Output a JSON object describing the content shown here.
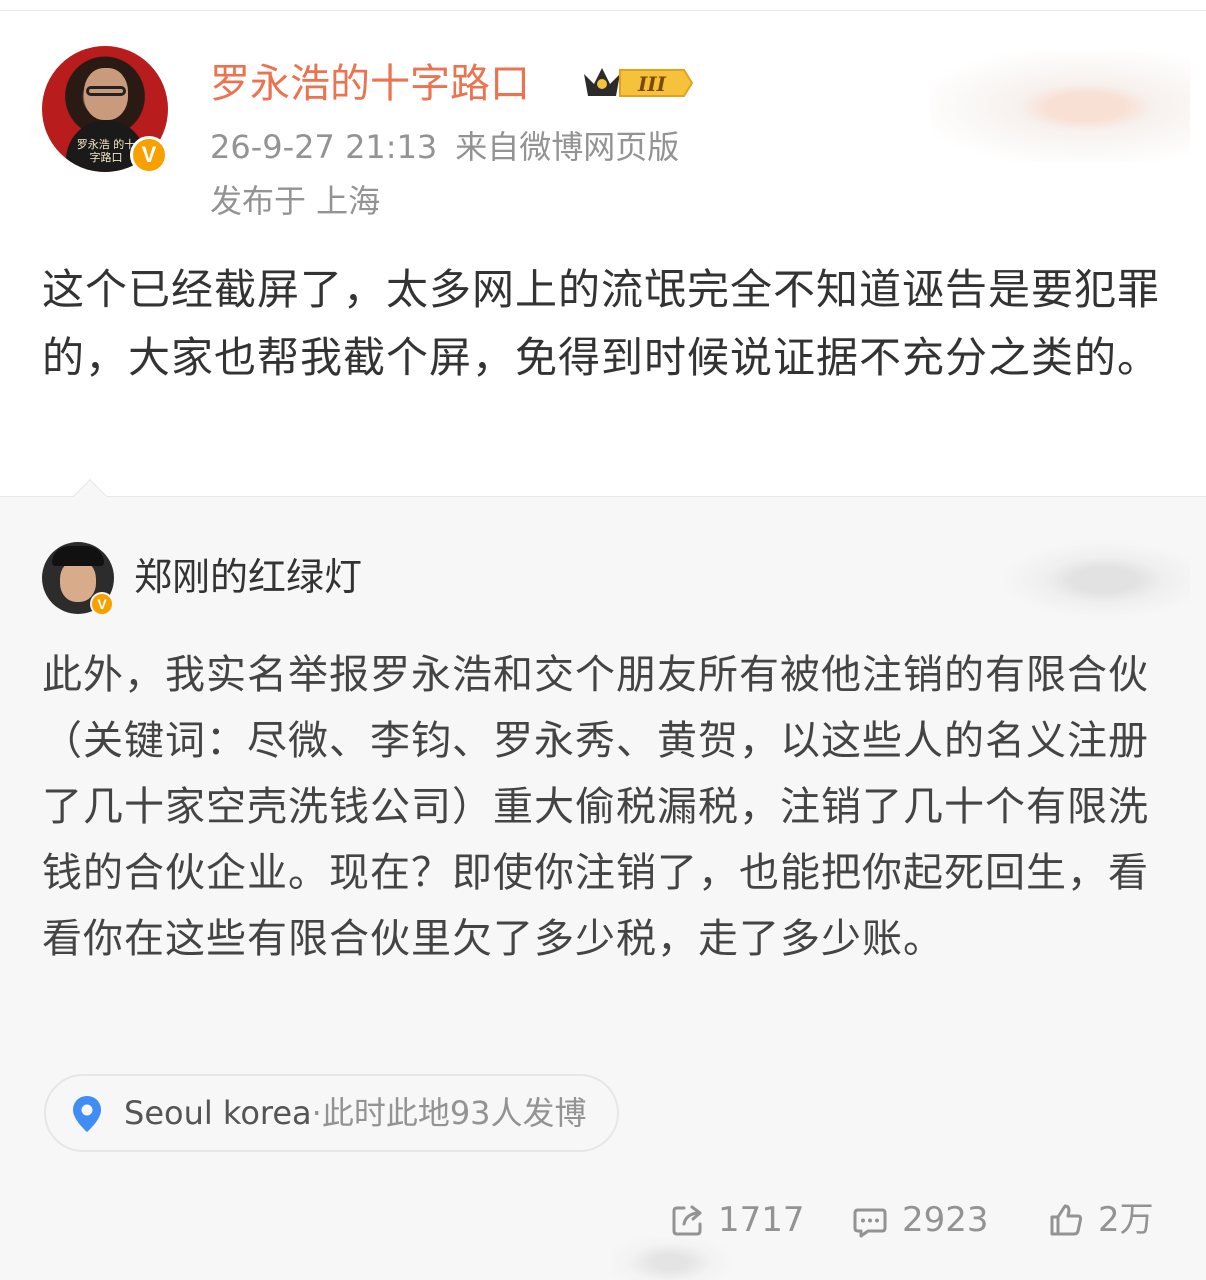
{
  "post": {
    "author": "罗永浩的十字路口",
    "avatar_caption": "罗永浩 的十字路口",
    "verified_mark": "V",
    "level_badge": "III",
    "timestamp": "26-9-27 21:13",
    "source": "来自微博网页版",
    "published_location": "发布于 上海",
    "text": "这个已经截屏了，太多网上的流氓完全不知道诬告是要犯罪的，大家也帮我截个屏，免得到时候说证据不充分之类的。"
  },
  "repost": {
    "author": "郑刚的红绿灯",
    "verified_mark": "V",
    "text": "此外，我实名举报罗永浩和交个朋友所有被他注销的有限合伙（关键词：尽微、李钧、罗永秀、黄贺，以这些人的名义注册了几十家空壳洗钱公司）重大偷税漏税，注销了几十个有限洗钱的合伙企业。现在？即使你注销了，也能把你起死回生，看看你在这些有限合伙里欠了多少税，走了多少账。",
    "location_tag": {
      "place": "Seoul korea",
      "count_text": "·此时此地93人发博"
    }
  },
  "actions": {
    "repost_count": "1717",
    "comment_count": "2923",
    "like_count": "2万"
  },
  "colors": {
    "username": "#eb7350",
    "meta": "#939393",
    "repost_bg": "#f7f7f7",
    "verified": "#f6a100",
    "location_pin": "#3f8df5"
  },
  "icons": {
    "level": "crown-icon",
    "location": "map-pin-icon",
    "repost": "share-icon",
    "comment": "comment-icon",
    "like": "thumbs-up-icon"
  }
}
